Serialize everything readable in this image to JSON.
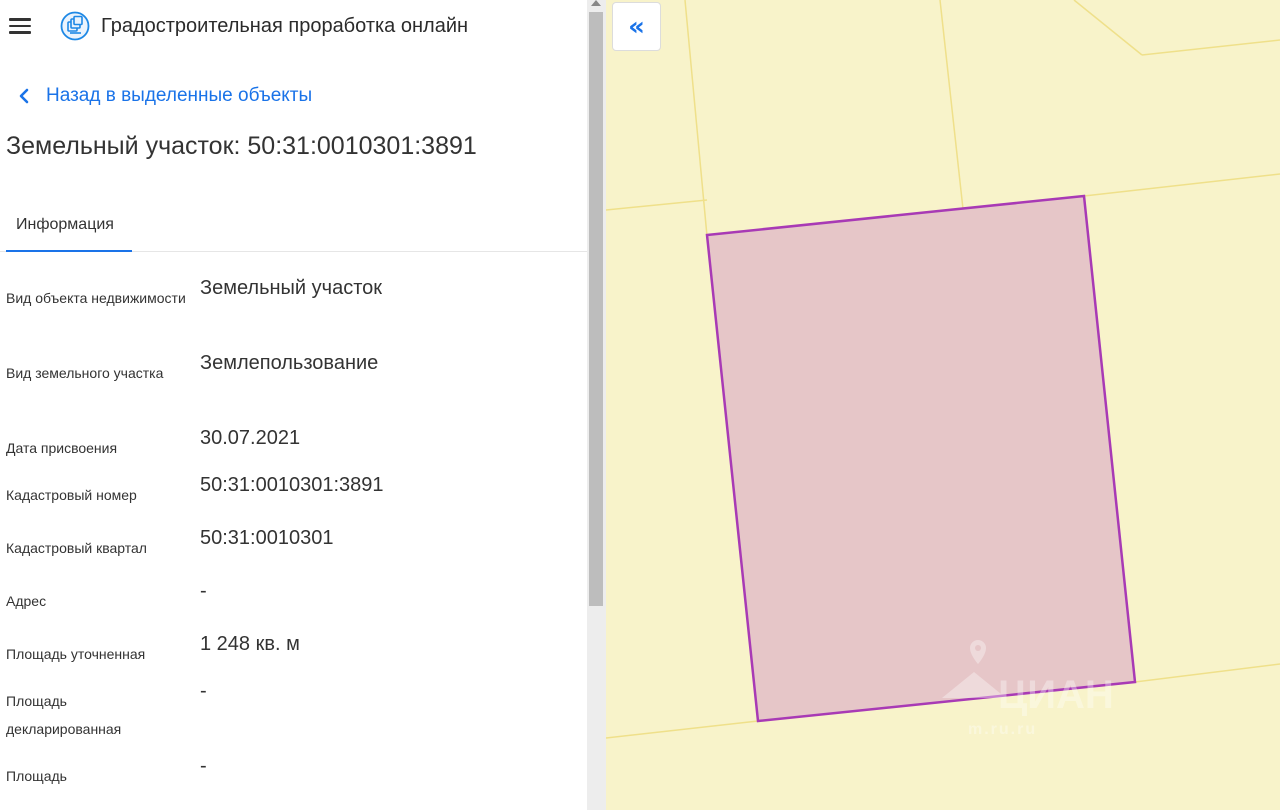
{
  "app": {
    "title": "Градостроительная проработка онлайн",
    "menu_icon": "hamburger-menu-icon",
    "logo_icon": "layers-logo-icon"
  },
  "navigation": {
    "back_label": "Назад в выделенные объекты",
    "back_icon": "chevron-left-icon"
  },
  "object": {
    "title": "Земельный участок: 50:31:0010301:3891"
  },
  "tabs": [
    {
      "label": "Информация",
      "active": true
    }
  ],
  "properties": [
    {
      "label": "Вид объекта недвижимости",
      "value": "Земельный участок"
    },
    {
      "label": "Вид земельного участка",
      "value": "Землепользование"
    },
    {
      "label": "Дата присвоения",
      "value": "30.07.2021"
    },
    {
      "label": "Кадастровый номер",
      "value": "50:31:0010301:3891"
    },
    {
      "label": "Кадастровый квартал",
      "value": "50:31:0010301"
    },
    {
      "label": "Адрес",
      "value": "-"
    },
    {
      "label": "Площадь уточненная",
      "value": "1 248 кв. м"
    },
    {
      "label": "Площадь декларированная",
      "value": "-"
    },
    {
      "label": "Площадь",
      "value": "-"
    }
  ],
  "map": {
    "collapse_label": "«",
    "collapse_icon": "double-chevron-left-icon",
    "watermark_text": "ЦИАН",
    "watermark_subtext": "m.ru.ru",
    "colors": {
      "background": "#f8f3ca",
      "parcel_lines": "#efe08a",
      "selected_fill": "#e6c6c8",
      "selected_stroke": "#a83ab5"
    }
  },
  "colors": {
    "accent": "#1a73e8",
    "text": "#333333"
  }
}
